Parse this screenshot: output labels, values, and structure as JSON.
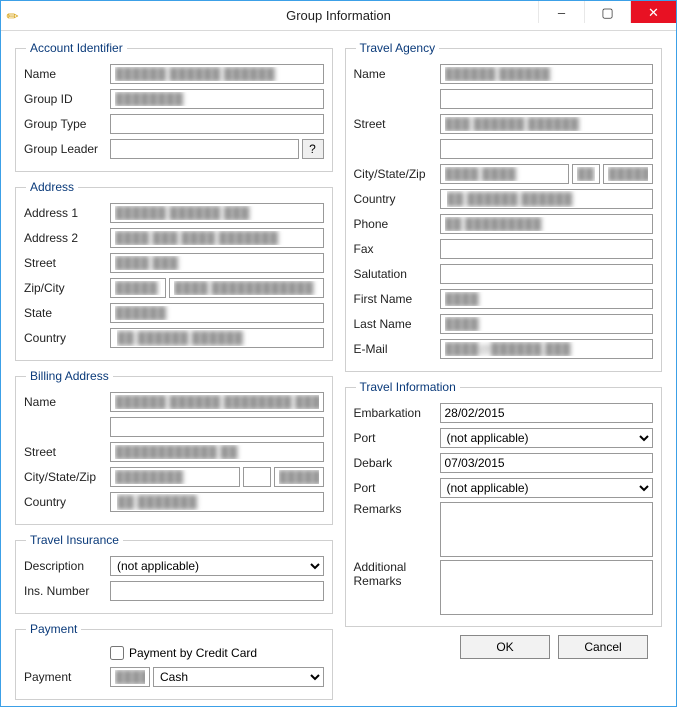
{
  "window": {
    "title": "Group Information",
    "minimize": "–",
    "maximize": "▢",
    "close": "✕"
  },
  "account": {
    "legend": "Account Identifier",
    "name_label": "Name",
    "name_value": "██████ ██████ ██████",
    "group_id_label": "Group ID",
    "group_id_value": "████████",
    "group_type_label": "Group Type",
    "group_type_value": "",
    "group_leader_label": "Group Leader",
    "group_leader_value": "",
    "help": "?"
  },
  "address": {
    "legend": "Address",
    "addr1_label": "Address 1",
    "addr1_value": "██████ ██████ ███",
    "addr2_label": "Address 2",
    "addr2_value": "████ ███ ████ ███████",
    "street_label": "Street",
    "street_value": "████ ███",
    "zipcity_label": "Zip/City",
    "zip_value": "█████",
    "city_value": "████ ████████████",
    "state_label": "State",
    "state_value": "██████",
    "country_label": "Country",
    "country_value": "██ ██████ ██████"
  },
  "billing": {
    "legend": "Billing Address",
    "name_label": "Name",
    "name_value": "██████ ██████ ████████ ████",
    "name2_value": "",
    "street_label": "Street",
    "street_value": "████████████ ██",
    "csz_label": "City/State/Zip",
    "city_value": "████████",
    "state_value": "",
    "zip_value": "█████",
    "country_label": "Country",
    "country_value": "██ ███████"
  },
  "insurance": {
    "legend": "Travel Insurance",
    "desc_label": "Description",
    "desc_value": "(not applicable)",
    "ins_num_label": "Ins. Number",
    "ins_num_value": ""
  },
  "payment": {
    "legend": "Payment",
    "cc_label": "Payment by Credit Card",
    "cc_checked": false,
    "payment_label": "Payment",
    "payment_code": "████",
    "payment_value": "Cash"
  },
  "agency": {
    "legend": "Travel Agency",
    "name_label": "Name",
    "name_value": "██████ ██████",
    "name2_value": "",
    "street_label": "Street",
    "street_value": "███ ██████ ██████",
    "street2_value": "",
    "csz_label": "City/State/Zip",
    "city_value": "████ ████",
    "state_value": "██",
    "zip_value": "█████",
    "country_label": "Country",
    "country_value": "██ ██████ ██████",
    "phone_label": "Phone",
    "phone_value": "██ █████████",
    "fax_label": "Fax",
    "fax_value": "",
    "salutation_label": "Salutation",
    "salutation_value": "",
    "first_label": "First Name",
    "first_value": "████",
    "last_label": "Last Name",
    "last_value": "████",
    "email_label": "E-Mail",
    "email_value": "████@██████.███"
  },
  "travel": {
    "legend": "Travel Information",
    "embark_label": "Embarkation",
    "embark_value": "28/02/2015",
    "port1_label": "Port",
    "port1_value": "(not applicable)",
    "debark_label": "Debark",
    "debark_value": "07/03/2015",
    "port2_label": "Port",
    "port2_value": "(not applicable)",
    "remarks_label": "Remarks",
    "remarks_value": "",
    "addl_label": "Additional Remarks",
    "addl_value": ""
  },
  "buttons": {
    "ok": "OK",
    "cancel": "Cancel"
  }
}
